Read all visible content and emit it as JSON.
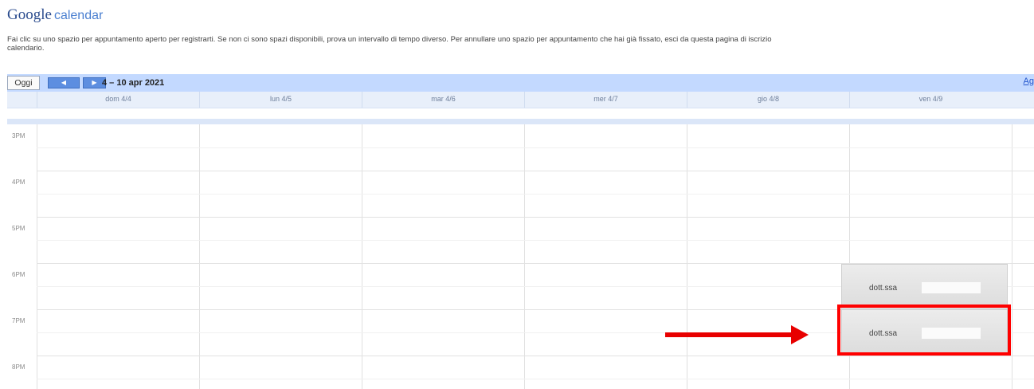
{
  "logo": {
    "brand": "Google",
    "product": "calendar"
  },
  "instructions": {
    "line1": "Fai clic su uno spazio per appuntamento aperto per registrarti. Se non ci sono spazi disponibili, prova un intervallo di tempo diverso. Per annullare uno spazio per appuntamento che hai già fissato, esci da questa pagina di iscrizio",
    "line2": "calendario."
  },
  "toolbar": {
    "today_label": "Oggi",
    "prev_icon": "chevron-left-icon",
    "next_icon": "chevron-right-icon",
    "prev_glyph": "◀",
    "next_glyph": "▶",
    "date_range": "4 – 10 apr 2021",
    "agenda_label": "Ag"
  },
  "days": [
    {
      "label": "dom 4/4"
    },
    {
      "label": "lun 4/5"
    },
    {
      "label": "mar 4/6"
    },
    {
      "label": "mer 4/7"
    },
    {
      "label": "gio 4/8"
    },
    {
      "label": "ven 4/9"
    }
  ],
  "hours": [
    "3PM",
    "4PM",
    "5PM",
    "6PM",
    "7PM",
    "8PM"
  ],
  "slots": [
    {
      "label": "dott.ssa",
      "day": "ven 4/9",
      "hour": "6PM"
    },
    {
      "label": "dott.ssa",
      "day": "ven 4/9",
      "hour": "7PM"
    }
  ],
  "colors": {
    "toolbar_bg": "#c3d9ff",
    "nav_button": "#5d8ee0",
    "annotation": "#ff0000"
  }
}
